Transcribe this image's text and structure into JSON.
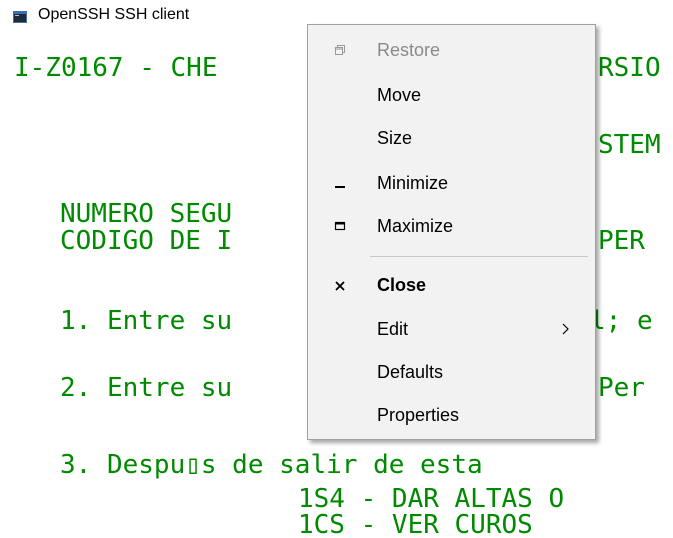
{
  "window": {
    "title": "OpenSSH SSH client",
    "icon": "console-window-icon"
  },
  "terminal": {
    "color": "#008a00",
    "lines": [
      "I-Z0167 - CHE",
      "RSIO",
      "STEM",
      "NUMERO SEGU",
      "CODIGO DE I",
      "PER",
      "1. Entre su",
      "l; e",
      "2. Entre su",
      "Per",
      "3. Despu▯s de salir de esta",
      "1S4 - DAR ALTAS O",
      "1CS - VER CUROS"
    ]
  },
  "context_menu": {
    "items": [
      {
        "label": "Restore",
        "icon": "restore-icon",
        "disabled": true
      },
      {
        "label": "Move"
      },
      {
        "label": "Size"
      },
      {
        "label": "Minimize",
        "icon": "minimize-icon"
      },
      {
        "label": "Maximize",
        "icon": "maximize-icon"
      },
      {
        "label": "Close",
        "icon": "close-icon",
        "bold": true
      },
      {
        "label": "Edit",
        "submenu": "chevron-right-icon"
      },
      {
        "label": "Defaults"
      },
      {
        "label": "Properties"
      }
    ]
  }
}
